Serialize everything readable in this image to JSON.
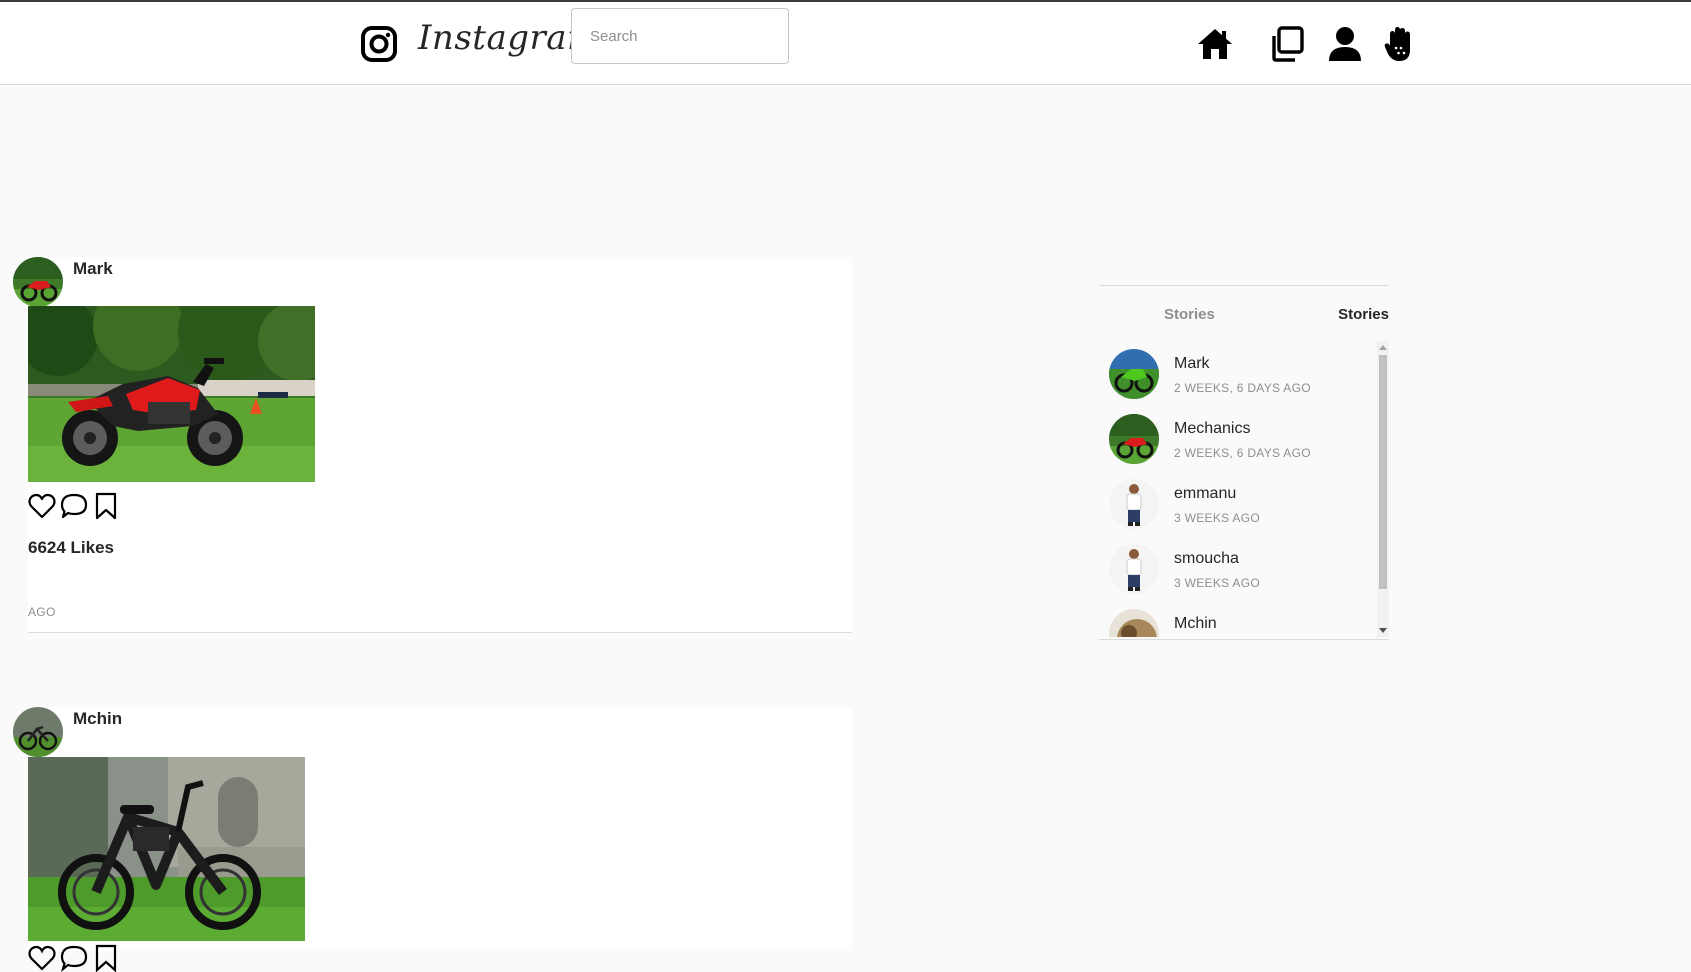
{
  "header": {
    "wordmark": "Instagram",
    "search_placeholder": "Search",
    "icons": [
      "instagram-logo-icon",
      "home-icon",
      "clone-icon",
      "user-icon",
      "hand-icon"
    ]
  },
  "posts": [
    {
      "username": "Mark",
      "likes": "6624 Likes",
      "time": "AGO",
      "image": "red-motorcycle-photo"
    },
    {
      "username": "Mchin",
      "image": "black-ebike-photo"
    }
  ],
  "stories": {
    "tab_left": "Stories",
    "tab_right": "Stories",
    "items": [
      {
        "name": "Mark",
        "time": "2 WEEKS, 6 DAYS AGO"
      },
      {
        "name": "Mechanics",
        "time": "2 WEEKS, 6 DAYS AGO"
      },
      {
        "name": "emmanu",
        "time": "3 WEEKS AGO"
      },
      {
        "name": "smoucha",
        "time": "3 WEEKS AGO"
      },
      {
        "name": "Mchin",
        "time": ""
      }
    ]
  },
  "colors": {
    "background": "#fafafa",
    "text": "#262626",
    "muted": "#8e8e8e",
    "border": "#dbdbdb",
    "bike_red": "#e01a1a",
    "grass": "#4a9a2b"
  }
}
